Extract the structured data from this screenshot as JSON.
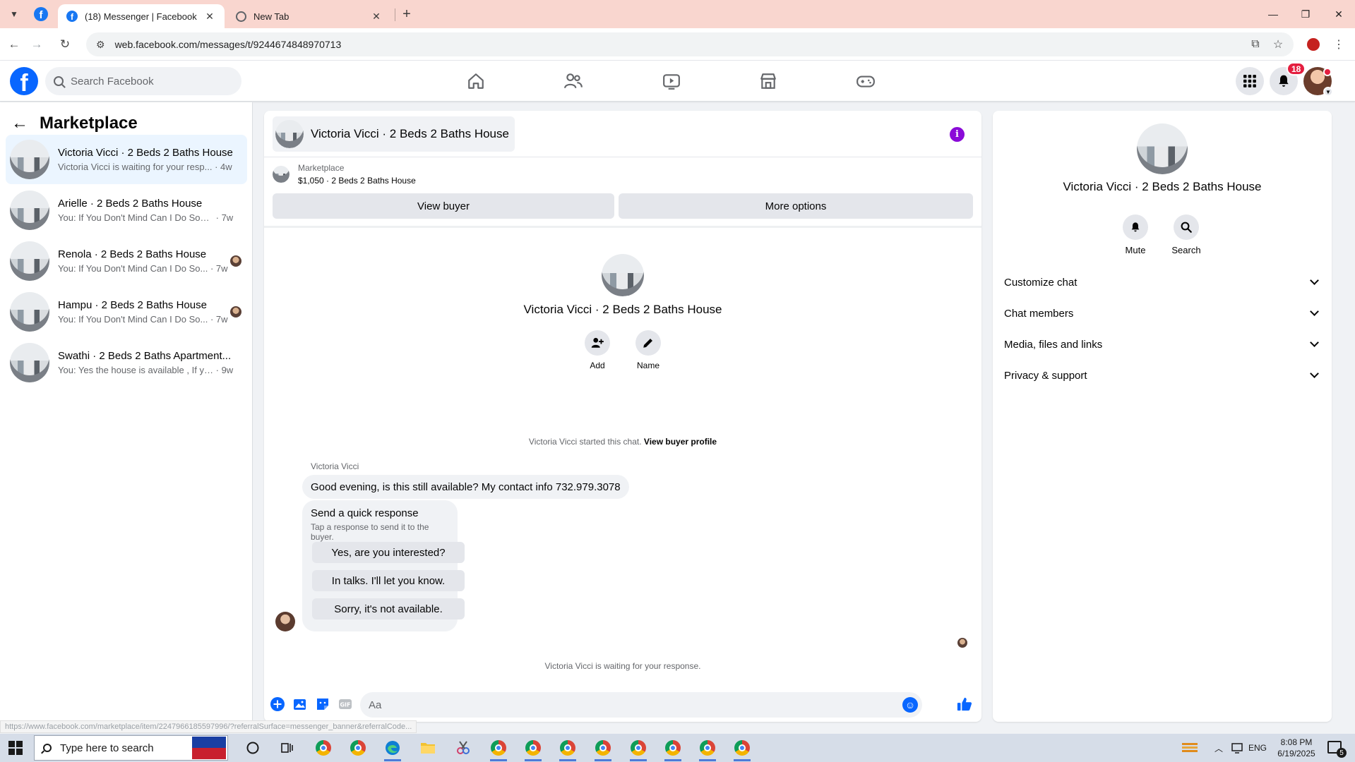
{
  "browser": {
    "active_tab_title": "(18) Messenger | Facebook",
    "inactive_tab_title": "New Tab",
    "url": "web.facebook.com/messages/t/9244674848970713",
    "status_url": "https://www.facebook.com/marketplace/item/2247966185597996/?referralSurface=messenger_banner&referralCode..."
  },
  "fb": {
    "search_placeholder": "Search Facebook",
    "notification_count": "18",
    "brand_color": "#0866ff"
  },
  "sidebar": {
    "title": "Marketplace",
    "conversations": [
      {
        "name": "Victoria Vicci · 2 Beds 2 Baths House",
        "preview": "Victoria Vicci is waiting for your resp...",
        "time": "· 4w"
      },
      {
        "name": "Arielle · 2 Beds 2 Baths House",
        "preview": "You: If You Don't Mind Can I Do Som...",
        "time": "· 7w"
      },
      {
        "name": "Renola · 2 Beds 2 Baths House",
        "preview": "You: If You Don't Mind Can I Do So...",
        "time": "· 7w"
      },
      {
        "name": "Hampu · 2 Beds 2 Baths House",
        "preview": "You: If You Don't Mind Can I Do So...",
        "time": "· 7w"
      },
      {
        "name": "Swathi · 2 Beds 2 Baths Apartment...",
        "preview": "You: Yes the house is available , If you...",
        "time": "· 9w"
      }
    ]
  },
  "chat": {
    "title": "Victoria Vicci · 2 Beds 2 Baths House",
    "marketplace_label": "Marketplace",
    "listing": "$1,050 · 2 Beds 2 Baths House",
    "view_buyer": "View buyer",
    "more_options": "More options",
    "intro_name": "Victoria Vicci · 2 Beds 2 Baths House",
    "add_label": "Add",
    "name_label": "Name",
    "started_text": "Victoria Vicci started this chat.",
    "view_profile": "View buyer profile",
    "sender": "Victoria Vicci",
    "message": "Good evening, is this still available?  My contact info 732.979.3078",
    "quick_title": "Send a quick response",
    "quick_sub": "Tap a response to send it to the buyer.",
    "quick_responses": [
      "Yes, are you interested?",
      "In talks. I'll let you know.",
      "Sorry, it's not available."
    ],
    "waiting": "Victoria Vicci is waiting for your response.",
    "composer_placeholder": "Aa"
  },
  "details": {
    "name": "Victoria Vicci · 2 Beds 2 Baths House",
    "mute": "Mute",
    "search": "Search",
    "sections": [
      "Customize chat",
      "Chat members",
      "Media, files and links",
      "Privacy & support"
    ]
  },
  "taskbar": {
    "search_placeholder": "Type here to search",
    "language": "ENG",
    "time": "8:08 PM",
    "date": "6/19/2025",
    "notification_count": "5"
  }
}
